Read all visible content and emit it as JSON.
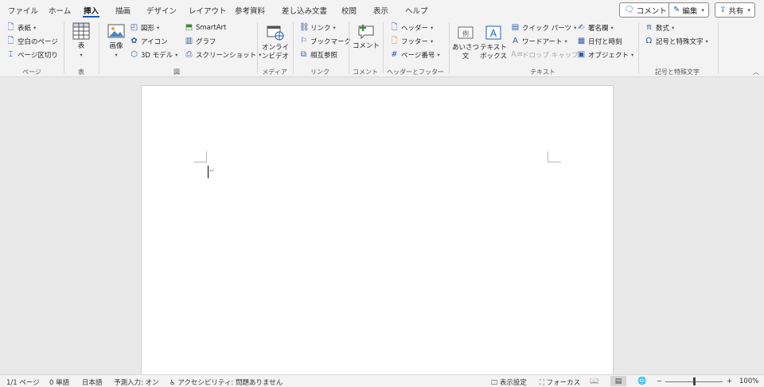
{
  "tabs": [
    "ファイル",
    "ホーム",
    "挿入",
    "描画",
    "デザイン",
    "レイアウト",
    "参考資料",
    "差し込み文書",
    "校閲",
    "表示",
    "ヘルプ"
  ],
  "active_tab": "挿入",
  "top_buttons": {
    "comment": "コメント",
    "edit": "編集",
    "share": "共有"
  },
  "ribbon": {
    "page_group": {
      "label": "ページ",
      "cover": "表紙",
      "blank": "空白のページ",
      "break": "ページ区切り"
    },
    "table_group": {
      "label": "表",
      "table": "表"
    },
    "illust_group": {
      "label": "図",
      "image": "画像",
      "shapes": "図形",
      "icons": "アイコン",
      "model3d": "3D モデル",
      "smartart": "SmartArt",
      "chart": "グラフ",
      "screenshot": "スクリーンショット"
    },
    "media_group": {
      "label": "メディア",
      "online_video_1": "オンライ",
      "online_video_2": "ンビデオ"
    },
    "link_group": {
      "label": "リンク",
      "link": "リンク",
      "bookmark": "ブックマーク",
      "crossref": "相互参照"
    },
    "comment_group": {
      "label": "コメント",
      "comment": "コメント"
    },
    "hf_group": {
      "label": "ヘッダーとフッター",
      "header": "ヘッダー",
      "footer": "フッター",
      "page_number": "ページ番号"
    },
    "text_group": {
      "label": "テキスト",
      "greeting_1": "あいさつ",
      "greeting_2": "文",
      "textbox_1": "テキスト",
      "textbox_2": "ボックス",
      "quickparts": "クイック パーツ",
      "wordart": "ワードアート",
      "dropcap": "ドロップ キャップ",
      "signature": "署名欄",
      "datetime": "日付と時刻",
      "object": "オブジェクト"
    },
    "symbol_group": {
      "label": "記号と特殊文字",
      "equation": "数式",
      "symbol": "記号と特殊文字"
    }
  },
  "status": {
    "page": "1/1 ページ",
    "words": "0 単語",
    "language": "日本語",
    "predict": "予測入力: オン",
    "accessibility": "アクセシビリティ: 問題ありません",
    "display_settings": "表示設定",
    "focus": "フォーカス",
    "zoom_minus": "−",
    "zoom_plus": "+",
    "zoom": "100%"
  },
  "colors": {
    "accent": "#185abd",
    "ribbon_bg": "#f3f3f3",
    "canvas_bg": "#e9e9e9"
  }
}
